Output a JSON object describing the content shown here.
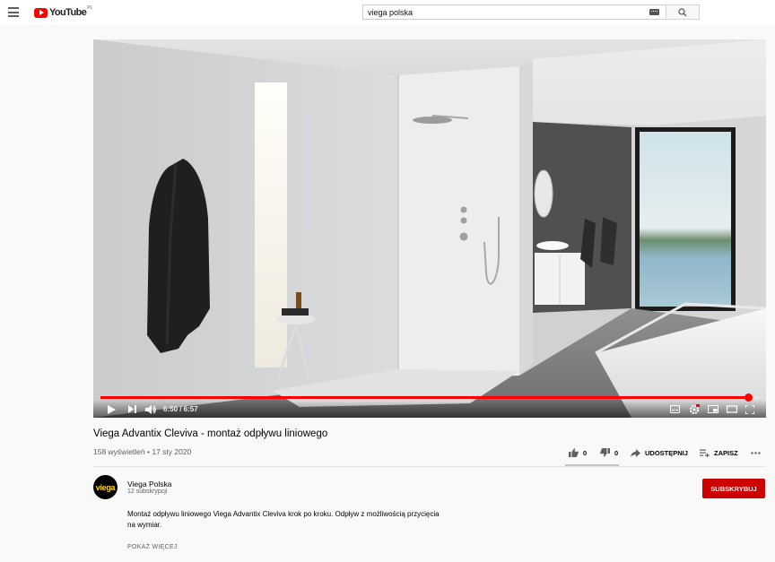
{
  "header": {
    "logo_text": "YouTube",
    "region": "PL",
    "search_value": "viega polska"
  },
  "player": {
    "time": "6:50 / 6:57",
    "progress": 0.983
  },
  "video": {
    "title": "Viega Advantix Cleviva - montaż odpływu liniowego",
    "views_date": "158 wyświetleń • 17 sty 2020",
    "likes": "0",
    "dislikes": "0",
    "share_label": "UDOSTĘPNIJ",
    "save_label": "ZAPISZ"
  },
  "channel": {
    "avatar_text": "viega",
    "name": "Viega Polska",
    "subscribers": "12 subskrypcji",
    "subscribe_label": "SUBSKRYBUJ"
  },
  "description": {
    "line1": "Montaż odpływu liniowego Viega Advantix Cleviva krok po kroku. Odpływ z możliwością przycięcia",
    "line2": "na wymiar.",
    "show_more": "POKAŻ WIĘCEJ"
  },
  "colors": {
    "brand_red": "#ff0000",
    "subscribe": "#cc0000",
    "viega_yellow": "#ffd500"
  }
}
